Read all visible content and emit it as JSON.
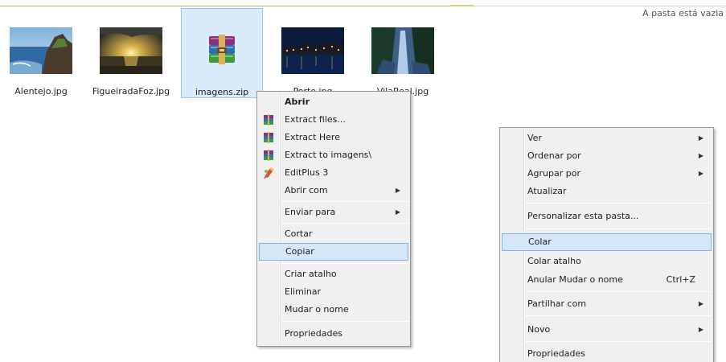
{
  "status_text": "A pasta está vazia",
  "files": [
    {
      "name": "Alentejo.jpg",
      "icon": "photo-coast-thumbnail"
    },
    {
      "name": "FigueiradaFoz.jpg",
      "icon": "photo-sunset-thumbnail"
    },
    {
      "name": "imagens.zip",
      "icon": "winrar-archive-icon"
    },
    {
      "name": "Porto.jpg",
      "icon": "photo-night-city-thumbnail"
    },
    {
      "name": "VilaReal.jpg",
      "icon": "photo-waterfall-thumbnail"
    }
  ],
  "file_menu": {
    "items": [
      {
        "label": "Abrir"
      },
      {
        "label": "Extract files...",
        "icon": "winrar-icon"
      },
      {
        "label": "Extract Here",
        "icon": "winrar-icon"
      },
      {
        "label": "Extract to imagens\\",
        "icon": "winrar-icon"
      },
      {
        "label": "EditPlus 3",
        "icon": "editplus-icon"
      },
      {
        "label": "Abrir com"
      },
      {
        "label": "Enviar para"
      },
      {
        "label": "Cortar"
      },
      {
        "label": "Copiar"
      },
      {
        "label": "Criar atalho"
      },
      {
        "label": "Eliminar"
      },
      {
        "label": "Mudar o nome"
      },
      {
        "label": "Propriedades"
      }
    ]
  },
  "folder_menu": {
    "items": [
      {
        "label": "Ver"
      },
      {
        "label": "Ordenar por"
      },
      {
        "label": "Agrupar por"
      },
      {
        "label": "Atualizar"
      },
      {
        "label": "Personalizar esta pasta..."
      },
      {
        "label": "Colar"
      },
      {
        "label": "Colar atalho"
      },
      {
        "label": "Anular Mudar o nome",
        "shortcut": "Ctrl+Z"
      },
      {
        "label": "Partilhar com"
      },
      {
        "label": "Novo"
      },
      {
        "label": "Propriedades"
      }
    ]
  },
  "colors": {
    "highlight": "#d5e6f7",
    "highlight_border": "#7eb4ea",
    "selection": "#d9eaf9",
    "menu_bg": "#f0f0f0"
  }
}
